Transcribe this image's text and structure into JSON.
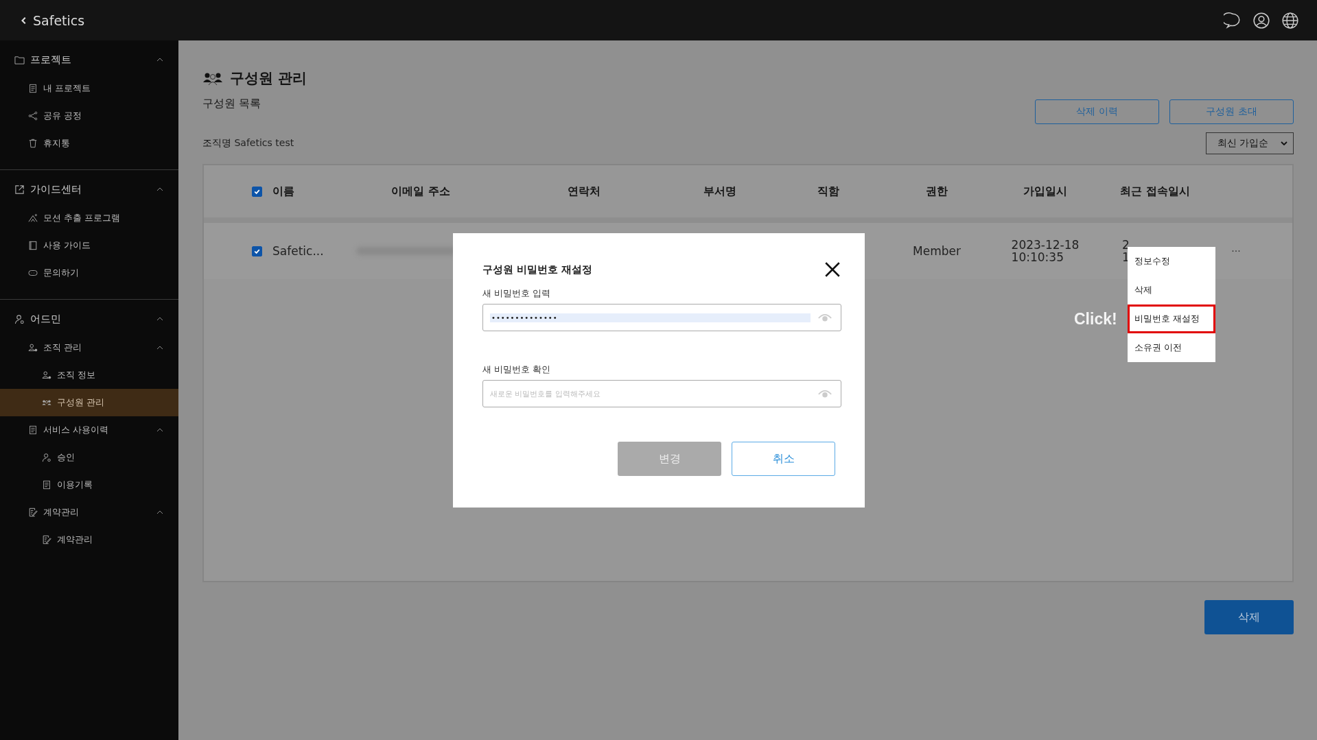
{
  "app": {
    "logo": "Safetics"
  },
  "sidebar": {
    "sections": [
      {
        "label": "프로젝트",
        "expanded": true,
        "children": [
          {
            "label": "내 프로젝트",
            "selected": false
          },
          {
            "label": "공유 공정",
            "selected": false
          },
          {
            "label": "휴지통",
            "selected": false
          }
        ]
      },
      {
        "label": "가이드센터",
        "expanded": true,
        "children": [
          {
            "label": "모션 추출 프로그램",
            "selected": false
          },
          {
            "label": "사용 가이드",
            "selected": false
          },
          {
            "label": "문의하기",
            "selected": false
          }
        ]
      },
      {
        "label": "어드민",
        "expanded": true,
        "children": [
          {
            "label": "조직 관리",
            "selected": false,
            "expanded": true,
            "children": [
              {
                "label": "조직 정보",
                "selected": false
              },
              {
                "label": "구성원 관리",
                "selected": true
              }
            ]
          },
          {
            "label": "서비스 사용이력",
            "selected": false,
            "expanded": true,
            "children": [
              {
                "label": "승인",
                "selected": false
              },
              {
                "label": "이용기록",
                "selected": false
              }
            ]
          },
          {
            "label": "계약관리",
            "selected": false,
            "expanded": true,
            "children": [
              {
                "label": "계약관리",
                "selected": false
              }
            ]
          }
        ]
      }
    ]
  },
  "page": {
    "title": "구성원 관리",
    "subtitle": "구성원 목록",
    "org_label": "조직명",
    "org_name": "Safetics test",
    "buttons": [
      "삭제 이력",
      "구성원 초대"
    ],
    "sort": "최신 가입순"
  },
  "table": {
    "header_checked": true,
    "columns": [
      "이름",
      "이메일 주소",
      "연락처",
      "부서명",
      "직함",
      "권한",
      "가입일시",
      "최근 접속일시"
    ],
    "rows": [
      {
        "checked": true,
        "name": "Safetic...",
        "email_blurred": true,
        "role": "Member",
        "joined": [
          "2023-12-18",
          "10:10:35"
        ],
        "last_access": [
          "2",
          "1"
        ],
        "more": "···"
      }
    ]
  },
  "delete_button": "삭제",
  "row_menu": {
    "items": [
      {
        "label": "정보수정",
        "selected": false
      },
      {
        "label": "삭제",
        "selected": false
      },
      {
        "label": "비밀번호 재설정",
        "selected": true
      },
      {
        "label": "소유권 이전",
        "selected": false
      }
    ],
    "callout": "Click!"
  },
  "dialog": {
    "title": "구성원 비밀번호 재설정",
    "fields": [
      {
        "label": "새 비밀번호 입력",
        "value": "••••••••••••••",
        "text_selected": true
      },
      {
        "label": "새 비밀번호 확인",
        "placeholder": "새로운 비밀번호를 입력해주세요"
      }
    ],
    "buttons": [
      {
        "label": "변경",
        "disabled": true
      },
      {
        "label": "취소",
        "disabled": false
      }
    ]
  }
}
